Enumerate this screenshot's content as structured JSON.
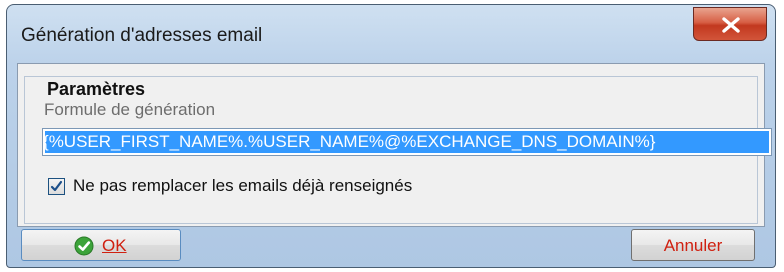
{
  "window": {
    "title": "Génération d'adresses email"
  },
  "group": {
    "title": "Paramètres"
  },
  "formula": {
    "label": "Formule de génération",
    "value": "%USER_FIRST_NAME%.%USER_NAME%@%EXCHANGE_DNS_DOMAIN%}",
    "visible_prefix": "{"
  },
  "options": {
    "no_replace_label": "Ne pas remplacer les emails déjà renseignés",
    "no_replace_checked": true
  },
  "buttons": {
    "ok_label": "OK",
    "cancel_label": "Annuler"
  },
  "icons": {
    "close": "close-x-icon",
    "ok": "green-check-circle-icon",
    "checkbox": "checkmark-icon"
  },
  "colors": {
    "selection": "#3399ff",
    "close_button": "#c2381f",
    "button_text": "#d02010"
  }
}
